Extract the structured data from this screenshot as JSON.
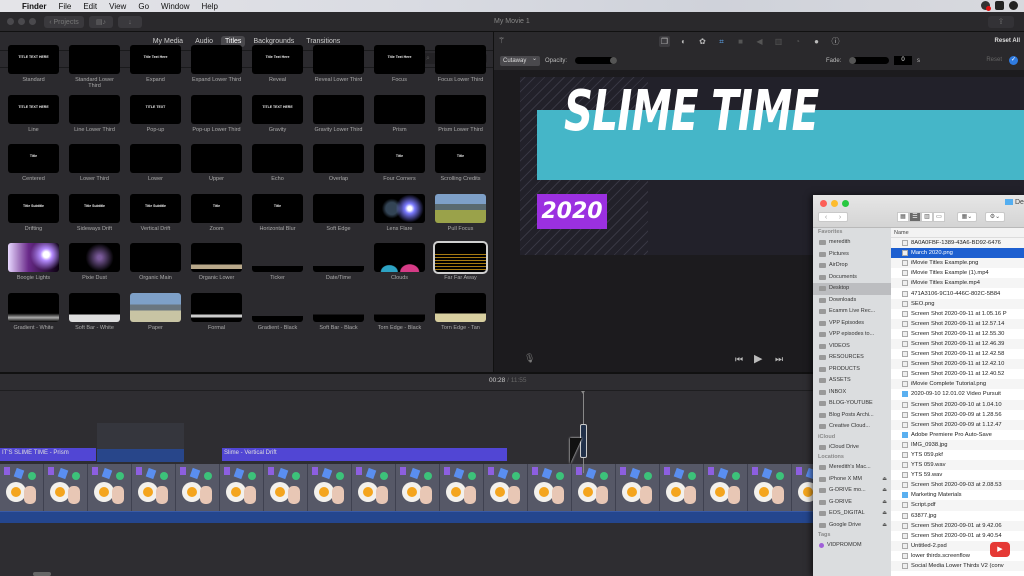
{
  "menubar": {
    "app": "Finder",
    "items": [
      "File",
      "Edit",
      "View",
      "Go",
      "Window",
      "Help"
    ]
  },
  "toolbar": {
    "projects_label": "Projects",
    "window_title": "My Movie 1"
  },
  "browser": {
    "tabs": [
      {
        "label": "My Media",
        "active": false
      },
      {
        "label": "Audio",
        "active": false
      },
      {
        "label": "Titles",
        "active": true
      },
      {
        "label": "Backgrounds",
        "active": false
      },
      {
        "label": "Transitions",
        "active": false
      }
    ],
    "section_label": "Titles",
    "search_placeholder": "Search",
    "titles": [
      {
        "name": "Standard",
        "thumb": "TITLE TEXT HERE"
      },
      {
        "name": "Standard Lower Third",
        "thumb": ""
      },
      {
        "name": "Expand",
        "thumb": "Title Text Here"
      },
      {
        "name": "Expand Lower Third",
        "thumb": ""
      },
      {
        "name": "Reveal",
        "thumb": "Title Text Here"
      },
      {
        "name": "Reveal Lower Third",
        "thumb": ""
      },
      {
        "name": "Focus",
        "thumb": "Title Text Here"
      },
      {
        "name": "Focus Lower Third",
        "thumb": ""
      },
      {
        "name": "Line",
        "thumb": "TITLE TEXT HERE"
      },
      {
        "name": "Line Lower Third",
        "thumb": ""
      },
      {
        "name": "Pop-up",
        "thumb": "TITLE TEXT"
      },
      {
        "name": "Pop-up Lower Third",
        "thumb": ""
      },
      {
        "name": "Gravity",
        "thumb": "TITLE TEXT HERE"
      },
      {
        "name": "Gravity Lower Third",
        "thumb": ""
      },
      {
        "name": "Prism",
        "thumb": ""
      },
      {
        "name": "Prism Lower Third",
        "thumb": ""
      },
      {
        "name": "Centered",
        "thumb": "Title"
      },
      {
        "name": "Lower Third",
        "thumb": ""
      },
      {
        "name": "Lower",
        "thumb": ""
      },
      {
        "name": "Upper",
        "thumb": ""
      },
      {
        "name": "Echo",
        "thumb": ""
      },
      {
        "name": "Overlap",
        "thumb": ""
      },
      {
        "name": "Four Corners",
        "thumb": "Title"
      },
      {
        "name": "Scrolling Credits",
        "thumb": "Title"
      },
      {
        "name": "Drifting",
        "thumb": "Title Subtitle"
      },
      {
        "name": "Sideways Drift",
        "thumb": "Title Subtitle"
      },
      {
        "name": "Vertical Drift",
        "thumb": "Title Subtitle"
      },
      {
        "name": "Zoom",
        "thumb": "Title"
      },
      {
        "name": "Horizontal Blur",
        "thumb": "Title"
      },
      {
        "name": "Soft Edge",
        "thumb": ""
      },
      {
        "name": "Lens Flare",
        "thumb": ""
      },
      {
        "name": "Pull Focus",
        "thumb": ""
      },
      {
        "name": "Boogie Lights",
        "thumb": ""
      },
      {
        "name": "Pixie Dust",
        "thumb": ""
      },
      {
        "name": "Organic Main",
        "thumb": ""
      },
      {
        "name": "Organic Lower",
        "thumb": ""
      },
      {
        "name": "Ticker",
        "thumb": ""
      },
      {
        "name": "Date/Time",
        "thumb": ""
      },
      {
        "name": "Clouds",
        "thumb": ""
      },
      {
        "name": "Far Far Away",
        "thumb": "",
        "selected": true
      },
      {
        "name": "Gradient - White",
        "thumb": ""
      },
      {
        "name": "Soft Bar - White",
        "thumb": ""
      },
      {
        "name": "Paper",
        "thumb": ""
      },
      {
        "name": "Formal",
        "thumb": ""
      },
      {
        "name": "Gradient - Black",
        "thumb": ""
      },
      {
        "name": "Soft Bar - Black",
        "thumb": ""
      },
      {
        "name": "Torn Edge - Black",
        "thumb": ""
      },
      {
        "name": "Torn Edge - Tan",
        "thumb": ""
      }
    ]
  },
  "inspector": {
    "reset_all": "Reset All",
    "mode": "Cutaway",
    "opacity_label": "Opacity:",
    "opacity_value": 1.0,
    "fade_label": "Fade:",
    "fade_value": "0",
    "fade_unit": "s",
    "reset_label": "Reset",
    "icons": [
      "video-overlay-icon",
      "color-balance-icon",
      "color-correction-icon",
      "crop-icon",
      "stabilization-icon",
      "volume-icon",
      "noise-reduction-icon",
      "speed-icon",
      "clip-filter-icon",
      "clip-info-icon"
    ]
  },
  "viewer": {
    "title_text": "SLIME TIME",
    "year_text": "2020",
    "colors": {
      "band": "#45b6c8",
      "badge": "#9b30e0"
    }
  },
  "timeline": {
    "current_time": "00:28",
    "separator": "/",
    "total_time": "11:55",
    "title_clips": [
      {
        "label": "IT'S SLIME TIME - Prism"
      },
      {
        "label": "Slime - Vertical Drift"
      }
    ]
  },
  "finder": {
    "title": "Desktop",
    "column_header": "Name",
    "sidebar": [
      {
        "type": "section",
        "label": "Favorites"
      },
      {
        "type": "item",
        "label": "meredith"
      },
      {
        "type": "item",
        "label": "Pictures"
      },
      {
        "type": "item",
        "label": "AirDrop"
      },
      {
        "type": "item",
        "label": "Documents"
      },
      {
        "type": "item",
        "label": "Desktop",
        "selected": true
      },
      {
        "type": "item",
        "label": "Downloads"
      },
      {
        "type": "item",
        "label": "Ecamm Live Rec..."
      },
      {
        "type": "item",
        "label": "VPP Episodes"
      },
      {
        "type": "item",
        "label": "VPP episodes to..."
      },
      {
        "type": "item",
        "label": "VIDEOS"
      },
      {
        "type": "item",
        "label": "RESOURCES"
      },
      {
        "type": "item",
        "label": "PRODUCTS"
      },
      {
        "type": "item",
        "label": "ASSETS"
      },
      {
        "type": "item",
        "label": "INBOX"
      },
      {
        "type": "item",
        "label": "BLOG-YOUTUBE"
      },
      {
        "type": "item",
        "label": "Blog Posts Archi..."
      },
      {
        "type": "item",
        "label": "Creative Cloud..."
      },
      {
        "type": "section",
        "label": "iCloud"
      },
      {
        "type": "item",
        "label": "iCloud Drive"
      },
      {
        "type": "section",
        "label": "Locations"
      },
      {
        "type": "item",
        "label": "Meredith's Mac..."
      },
      {
        "type": "item",
        "label": "iPhone X MM",
        "eject": true
      },
      {
        "type": "item",
        "label": "G-DRIVE mo...",
        "eject": true
      },
      {
        "type": "item",
        "label": "G-DRIVE",
        "eject": true
      },
      {
        "type": "item",
        "label": "EOS_DIGITAL",
        "eject": true
      },
      {
        "type": "item",
        "label": "Google Drive",
        "eject": true
      },
      {
        "type": "section",
        "label": "Tags"
      },
      {
        "type": "tag",
        "label": "VIDPROMOM"
      }
    ],
    "files": [
      {
        "name": "8A0A0FBF-1389-43A6-BD92-6476",
        "kind": "file"
      },
      {
        "name": "March 2020.png",
        "kind": "image",
        "selected": true
      },
      {
        "name": "iMovie Titles Example.png",
        "kind": "image"
      },
      {
        "name": "iMovie Titles Example (1).mp4",
        "kind": "video"
      },
      {
        "name": "iMovie Titles Example.mp4",
        "kind": "video"
      },
      {
        "name": "471A3106-9C10-446C-802C-5B84",
        "kind": "file"
      },
      {
        "name": "SEO.png",
        "kind": "image"
      },
      {
        "name": "Screen Shot 2020-09-11 at 1.05.16 P",
        "kind": "image"
      },
      {
        "name": "Screen Shot 2020-09-11 at 12.57.14",
        "kind": "image"
      },
      {
        "name": "Screen Shot 2020-09-11 at 12.55.30",
        "kind": "image"
      },
      {
        "name": "Screen Shot 2020-09-11 at 12.46.39",
        "kind": "image"
      },
      {
        "name": "Screen Shot 2020-09-11 at 12.42.58",
        "kind": "image"
      },
      {
        "name": "Screen Shot 2020-09-11 at 12.42.10",
        "kind": "image"
      },
      {
        "name": "Screen Shot 2020-09-11 at 12.40.52",
        "kind": "image"
      },
      {
        "name": "iMovie Complete Tutorial.png",
        "kind": "image"
      },
      {
        "name": "2020-09-10 12.01.02 Video Pursuit",
        "kind": "folder"
      },
      {
        "name": "Screen Shot 2020-09-10 at 1.04.10",
        "kind": "image"
      },
      {
        "name": "Screen Shot 2020-09-09 at 1.28.56",
        "kind": "image"
      },
      {
        "name": "Screen Shot 2020-09-09 at 1.12.47",
        "kind": "image"
      },
      {
        "name": "Adobe Premiere Pro Auto-Save",
        "kind": "folder"
      },
      {
        "name": "IMG_0938.jpg",
        "kind": "image"
      },
      {
        "name": "YTS 059.pkf",
        "kind": "file"
      },
      {
        "name": "YTS 059.wav",
        "kind": "audio"
      },
      {
        "name": "YTS 59.wav",
        "kind": "audio"
      },
      {
        "name": "Screen Shot 2020-09-03 at 2.08.53",
        "kind": "image"
      },
      {
        "name": "Marketing Materials",
        "kind": "folder"
      },
      {
        "name": "Script.pdf",
        "kind": "pdf"
      },
      {
        "name": "63877.jpg",
        "kind": "image"
      },
      {
        "name": "Screen Shot 2020-09-01 at 9.42.06",
        "kind": "image"
      },
      {
        "name": "Screen Shot 2020-09-01 at 9.40.54",
        "kind": "image"
      },
      {
        "name": "Untitled-2.psd",
        "kind": "image"
      },
      {
        "name": "lower thirds.screenflow",
        "kind": "file"
      },
      {
        "name": "Social Media Lower Thirds V2 (conv",
        "kind": "file"
      }
    ]
  }
}
